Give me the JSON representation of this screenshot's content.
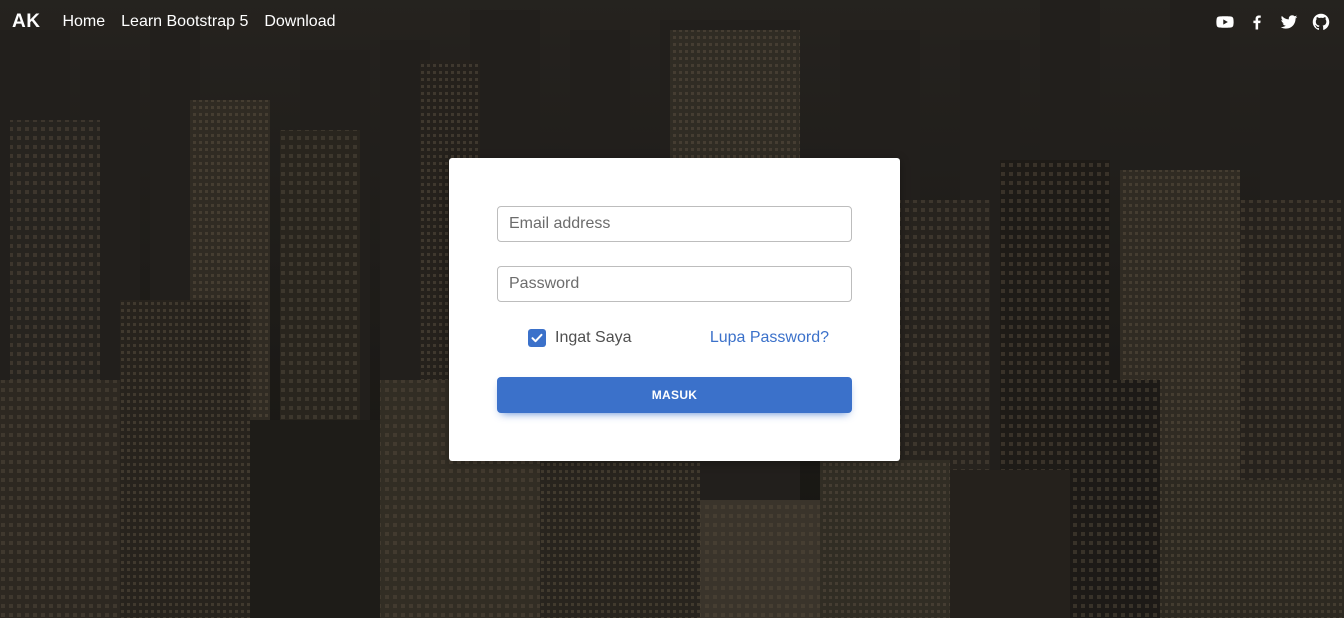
{
  "navbar": {
    "brand": "AK",
    "links": [
      "Home",
      "Learn Bootstrap 5",
      "Download"
    ],
    "social_icons": [
      "youtube-icon",
      "facebook-icon",
      "twitter-icon",
      "github-icon"
    ]
  },
  "login": {
    "email_placeholder": "Email address",
    "password_placeholder": "Password",
    "remember_label": "Ingat Saya",
    "remember_checked": true,
    "forgot_label": "Lupa Password?",
    "submit_label": "MASUK"
  },
  "colors": {
    "primary": "#3b71ca",
    "card": "#ffffff",
    "text": "#ffffff"
  }
}
